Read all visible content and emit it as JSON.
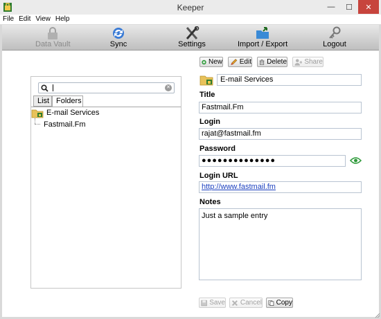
{
  "window": {
    "title": "Keeper",
    "minimize": "—",
    "maximize": "☐",
    "close": "✕"
  },
  "menu": [
    "File",
    "Edit",
    "View",
    "Help"
  ],
  "toolbar": {
    "data_vault": "Data Vault",
    "sync": "Sync",
    "settings": "Settings",
    "import_export": "Import / Export",
    "logout": "Logout"
  },
  "search": {
    "value": "",
    "placeholder": ""
  },
  "tabs": {
    "list": "List",
    "folders": "Folders"
  },
  "tree": {
    "folder": "E-mail Services",
    "record": "Fastmail.Fm"
  },
  "actions": {
    "new": "New",
    "edit": "Edit",
    "delete": "Delete",
    "share": "Share"
  },
  "record": {
    "folder": "E-mail Services",
    "title_label": "Title",
    "title": "Fastmail.Fm",
    "login_label": "Login",
    "login": "rajat@fastmail.fm",
    "password_label": "Password",
    "password_mask": "●●●●●●●●●●●●●●",
    "url_label": "Login URL",
    "url": "http://www.fastmail.fm",
    "notes_label": "Notes",
    "notes": "Just a sample entry"
  },
  "footer": {
    "save": "Save",
    "cancel": "Cancel",
    "copy": "Copy"
  },
  "colors": {
    "accent_green": "#2e9a3a",
    "link_blue": "#1a3fbf",
    "close_red": "#c7443d"
  }
}
